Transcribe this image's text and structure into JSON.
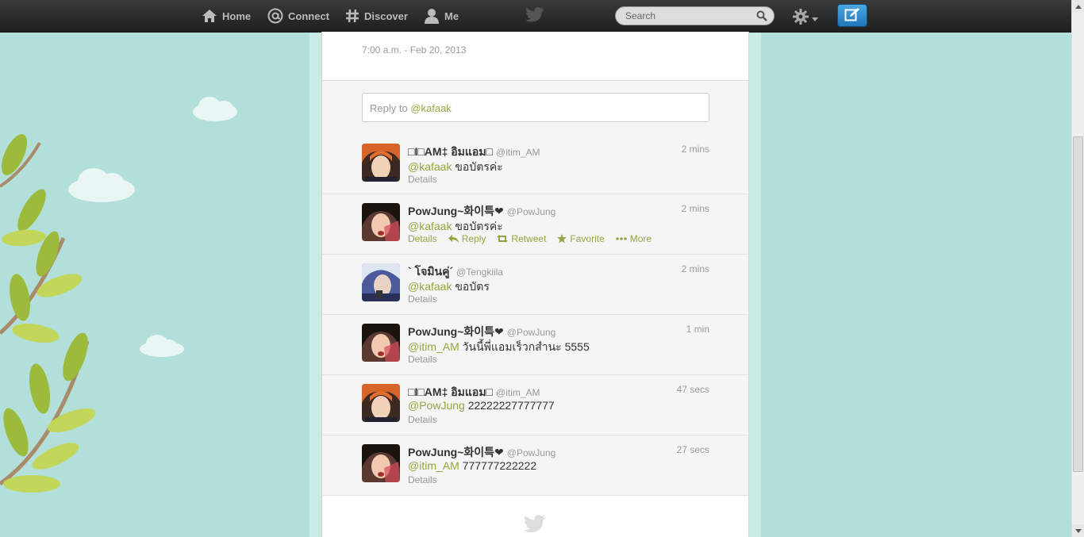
{
  "nav": {
    "home": "Home",
    "connect": "Connect",
    "discover": "Discover",
    "me": "Me",
    "search_placeholder": "Search"
  },
  "tweet_detail": {
    "timestamp": "7:00 a.m. - Feb 20, 2013"
  },
  "reply": {
    "prefix": "Reply to ",
    "mention": "@kafaak"
  },
  "actions": {
    "details": "Details",
    "reply": "Reply",
    "retweet": "Retweet",
    "favorite": "Favorite",
    "more": "More"
  },
  "tweets": [
    {
      "name": "□I□AM‡ อิมแอม□",
      "handle": "@itim_AM",
      "time": "2 mins",
      "mention": "@kafaak",
      "text": " ขอบัตรค่ะ",
      "avatar": "orange"
    },
    {
      "name": "PowJung~화이특❤",
      "handle": "@PowJung",
      "time": "2 mins",
      "mention": "@kafaak",
      "text": " ขอบัตรค่ะ",
      "avatar": "dark"
    },
    {
      "name": "` โจมินคู่´",
      "handle": "@Tengkiila",
      "time": "2 mins",
      "mention": "@kafaak",
      "text": " ขอบัตร",
      "avatar": "blue"
    },
    {
      "name": "PowJung~화이특❤",
      "handle": "@PowJung",
      "time": "1 min",
      "mention": "@itim_AM",
      "text": " วันนี้พี่แอมเร็วกสำนะ 5555",
      "avatar": "dark"
    },
    {
      "name": "□I□AM‡ อิมแอม□",
      "handle": "@itim_AM",
      "time": "47 secs",
      "mention": "@PowJung",
      "text": " 22222227777777",
      "avatar": "orange"
    },
    {
      "name": "PowJung~화이특❤",
      "handle": "@PowJung",
      "time": "27 secs",
      "mention": "@itim_AM",
      "text": " 777777222222",
      "avatar": "dark"
    }
  ],
  "colors": {
    "background": "#b2dfda",
    "mention": "#93a644",
    "compose": "#2a88c9"
  }
}
